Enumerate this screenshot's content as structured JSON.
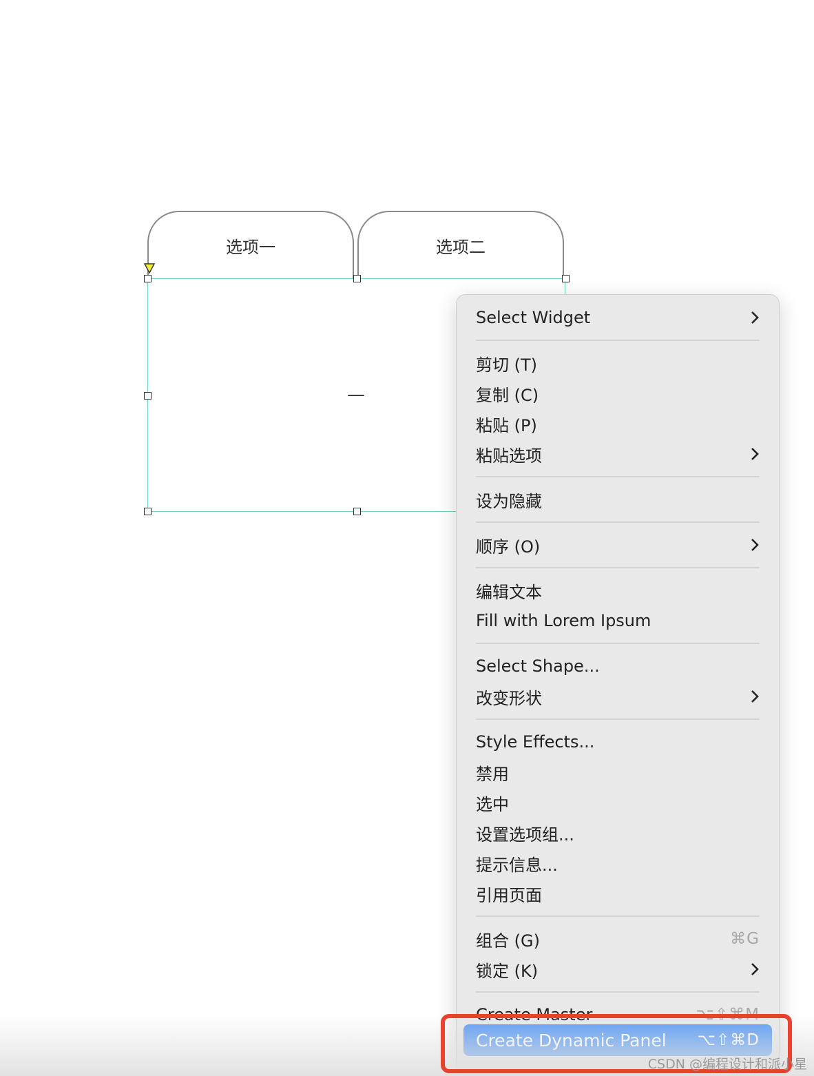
{
  "tabs": [
    {
      "label": "选项一"
    },
    {
      "label": "选项二"
    }
  ],
  "panel": {
    "center_text": "—"
  },
  "menu": {
    "select_widget": "Select Widget",
    "cut": "剪切 (T)",
    "copy": "复制 (C)",
    "paste": "粘贴 (P)",
    "paste_options": "粘贴选项",
    "set_hidden": "设为隐藏",
    "order": "顺序 (O)",
    "edit_text": "编辑文本",
    "fill_lorem": "Fill with Lorem Ipsum",
    "select_shape": "Select Shape...",
    "change_shape": "改变形状",
    "style_effects": "Style Effects...",
    "disable": "禁用",
    "selected": "选中",
    "set_option_group": "设置选项组...",
    "tooltip": "提示信息...",
    "reference_page": "引用页面",
    "group": "组合 (G)",
    "group_shortcut": "⌘G",
    "lock": "锁定 (K)",
    "create_master": "Create Master",
    "create_master_shortcut": "⌥⇧⌘M",
    "create_dynamic_panel": "Create Dynamic Panel",
    "create_dynamic_panel_shortcut": "⌥⇧⌘D"
  },
  "watermark": "CSDN @编程设计和派小星"
}
